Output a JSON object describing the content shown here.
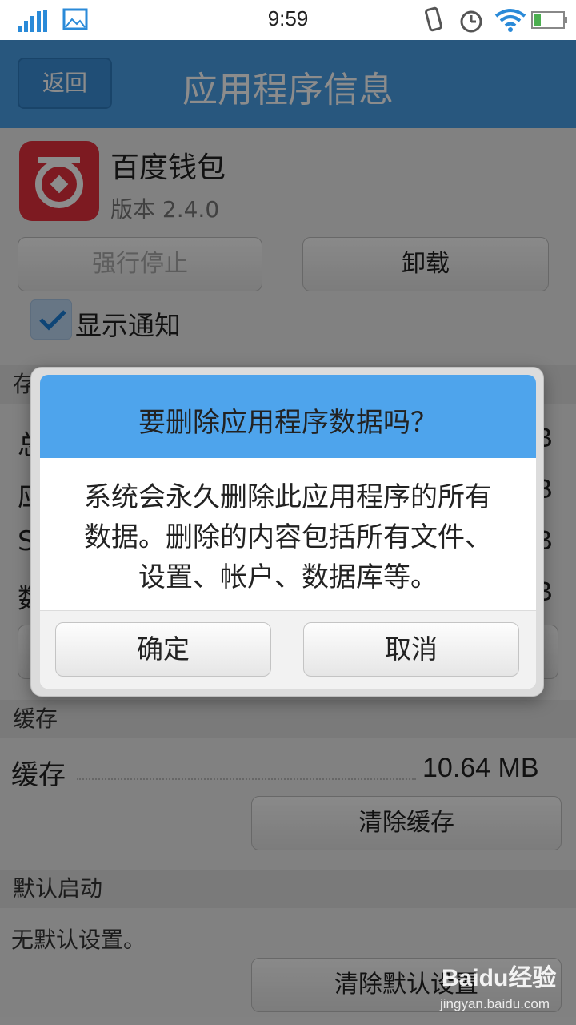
{
  "status_bar": {
    "time": "9:59",
    "icons": [
      "signal-icon",
      "image-icon",
      "vibrate-icon",
      "alarm-icon",
      "wifi-icon",
      "battery-icon"
    ]
  },
  "title_bar": {
    "back_label": "返回",
    "title": "应用程序信息"
  },
  "app": {
    "name": "百度钱包",
    "version": "版本 2.4.0",
    "force_stop_label": "强行停止",
    "uninstall_label": "卸载",
    "show_notification_label": "显示通知",
    "show_notification_checked": true,
    "icon_color": "#e4313d"
  },
  "storage": {
    "header_partial": "存储",
    "rows": [
      {
        "label_partial": "总",
        "value_partial": "B"
      },
      {
        "label_partial": "应",
        "value_partial": "B"
      },
      {
        "label_partial": "S",
        "value_partial": "B"
      },
      {
        "label_partial": "数",
        "value_partial": "B"
      }
    ]
  },
  "cache": {
    "header": "缓存",
    "label": "缓存",
    "value": "10.64 MB",
    "clear_label": "清除缓存"
  },
  "default_launch": {
    "header": "默认启动",
    "text": "无默认设置。",
    "clear_label": "清除默认设置"
  },
  "dialog": {
    "title": "要删除应用程序数据吗？",
    "body_lines": [
      "系统会永久删除此应用程序的所有",
      "数据。删除的内容包括所有文件、",
      "设置、帐户、数据库等。"
    ],
    "confirm_label": "确定",
    "cancel_label": "取消",
    "accent": "#4ea4ec"
  },
  "watermark": {
    "logo": "Baidu经验",
    "url": "jingyan.baidu.com"
  }
}
